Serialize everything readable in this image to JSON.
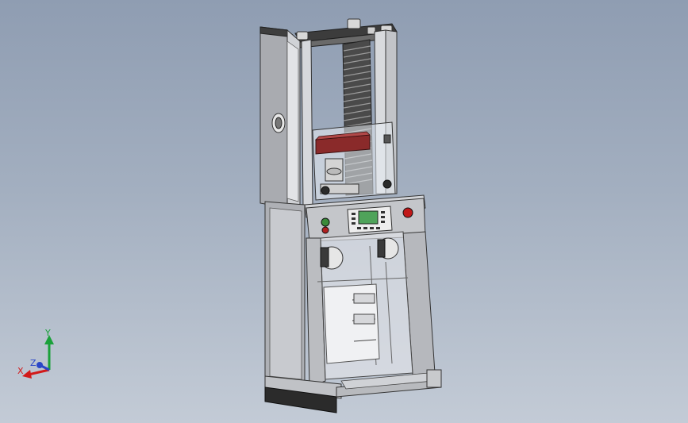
{
  "viewport": {
    "background_top": "#8f9db2",
    "background_bottom": "#c3cbd6"
  },
  "model": {
    "frame_color": "#c9cbd0",
    "panel_color": "#b3b5ba",
    "outline_color": "#3a3a3a",
    "crosshead_color": "#8a2a2a",
    "screen_color": "#4fa35a",
    "base_color": "#2b2b2b"
  },
  "triad": {
    "x_label": "X",
    "y_label": "Y",
    "z_label": "Z",
    "x_color": "#d21a1a",
    "y_color": "#1aa13a",
    "z_color": "#2a46c8"
  }
}
